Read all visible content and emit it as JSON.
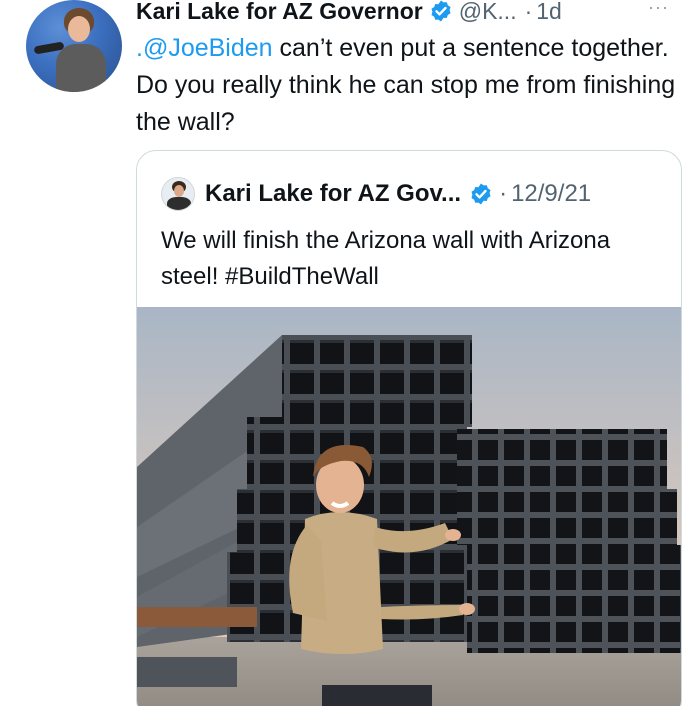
{
  "tweet": {
    "display_name": "Kari Lake for AZ Governor",
    "handle": "@K...",
    "separator": "·",
    "time": "1d",
    "more": "···",
    "mention": ".@JoeBiden",
    "text": " can’t even put a sentence together. Do you really think he can stop me from finishing the wall?"
  },
  "quoted_tweet": {
    "display_name": "Kari Lake for AZ Gov...",
    "separator": "·",
    "date": "12/9/21",
    "text": "We will finish the Arizona wall with Arizona steel! #BuildTheWall"
  },
  "colors": {
    "accent": "#1d9bf0",
    "text": "#0f1419",
    "secondary": "#536471",
    "border": "#cfd9de"
  },
  "icons": {
    "verified": "verified-badge-icon",
    "more": "more-options-icon"
  }
}
